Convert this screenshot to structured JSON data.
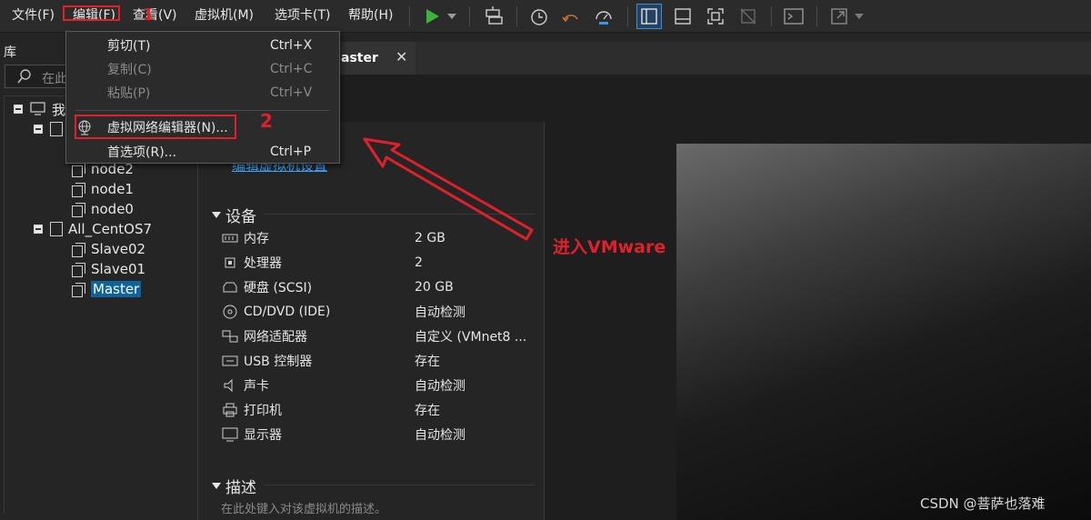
{
  "menubar": {
    "file": "文件(F)",
    "edit": "编辑(F)",
    "view": "查看(V)",
    "vm": "虚拟机(M)",
    "tabs": "选项卡(T)",
    "help": "帮助(H)"
  },
  "library": {
    "title": "库",
    "search_placeholder": "在此",
    "nodes": [
      "我",
      "node2",
      "node1",
      "node0",
      "All_CentOS7",
      "Slave02",
      "Slave01",
      "Master"
    ]
  },
  "tab": {
    "label": "aster",
    "close": "✕"
  },
  "summary": {
    "edit_link": "编辑虚拟机设置",
    "devices_title": "设备",
    "devices": [
      {
        "name": "内存",
        "value": "2 GB",
        "icon": "memory-icon"
      },
      {
        "name": "处理器",
        "value": "2",
        "icon": "cpu-icon"
      },
      {
        "name": "硬盘 (SCSI)",
        "value": "20 GB",
        "icon": "disk-icon"
      },
      {
        "name": "CD/DVD (IDE)",
        "value": "自动检测",
        "icon": "cd-icon"
      },
      {
        "name": "网络适配器",
        "value": "自定义 (VMnet8 ...",
        "icon": "network-icon"
      },
      {
        "name": "USB 控制器",
        "value": "存在",
        "icon": "usb-icon"
      },
      {
        "name": "声卡",
        "value": "自动检测",
        "icon": "speaker-icon"
      },
      {
        "name": "打印机",
        "value": "存在",
        "icon": "printer-icon"
      },
      {
        "name": "显示器",
        "value": "自动检测",
        "icon": "monitor-icon"
      }
    ],
    "desc_title": "描述",
    "desc_placeholder": "在此处键入对该虚拟机的描述。"
  },
  "edit_menu": {
    "cut": "剪切(T)",
    "cut_key": "Ctrl+X",
    "copy": "复制(C)",
    "copy_key": "Ctrl+C",
    "paste": "粘贴(P)",
    "paste_key": "Ctrl+V",
    "vnet": "虚拟网络编辑器(N)...",
    "prefs": "首选项(R)...",
    "prefs_key": "Ctrl+P"
  },
  "annotations": {
    "step1": "1",
    "step2": "2",
    "note": "进入VMware"
  },
  "watermark": "CSDN @菩萨也落难",
  "colors": {
    "accent": "#0e639c",
    "annotation": "#e0202a",
    "link": "#3ea6ff"
  }
}
